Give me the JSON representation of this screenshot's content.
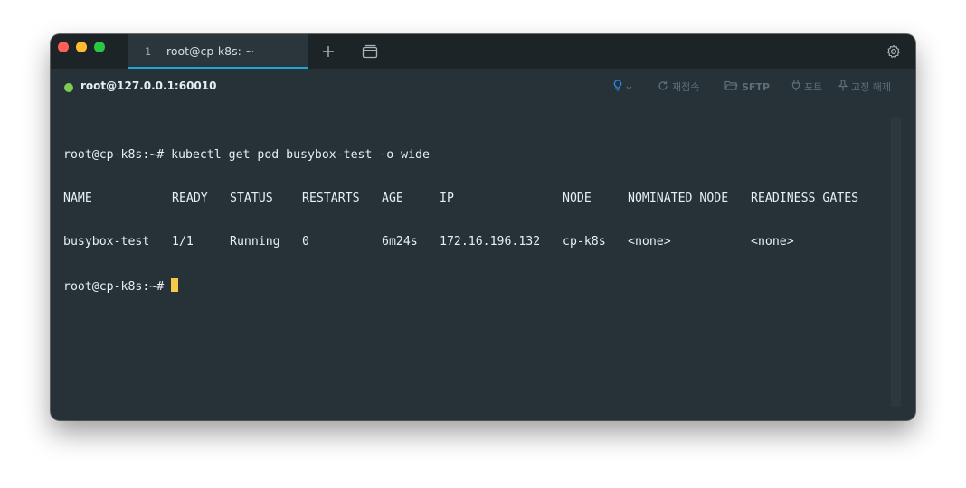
{
  "window": {
    "tab": {
      "index": "1",
      "title": "root@cp-k8s: ~"
    },
    "accent_color": "#1ea6d8",
    "background_color": "#263238"
  },
  "statusbar": {
    "connection_status_color": "#7ecb52",
    "host": "root@127.0.0.1:60010",
    "tools": {
      "hint_icon": "lightbulb-icon",
      "reconnect_label": "재접속",
      "sftp_label": "SFTP",
      "port_label": "포트",
      "pin_label": "고정 해제"
    }
  },
  "terminal": {
    "prompt": "root@cp-k8s:~#",
    "command": "kubectl get pod busybox-test -o wide",
    "table": {
      "headers": [
        "NAME",
        "READY",
        "STATUS",
        "RESTARTS",
        "AGE",
        "IP",
        "NODE",
        "NOMINATED NODE",
        "READINESS GATES"
      ],
      "rows": [
        [
          "busybox-test",
          "1/1",
          "Running",
          "0",
          "6m24s",
          "172.16.196.132",
          "cp-k8s",
          "<none>",
          "<none>"
        ]
      ]
    },
    "cursor_color": "#f7c948"
  }
}
